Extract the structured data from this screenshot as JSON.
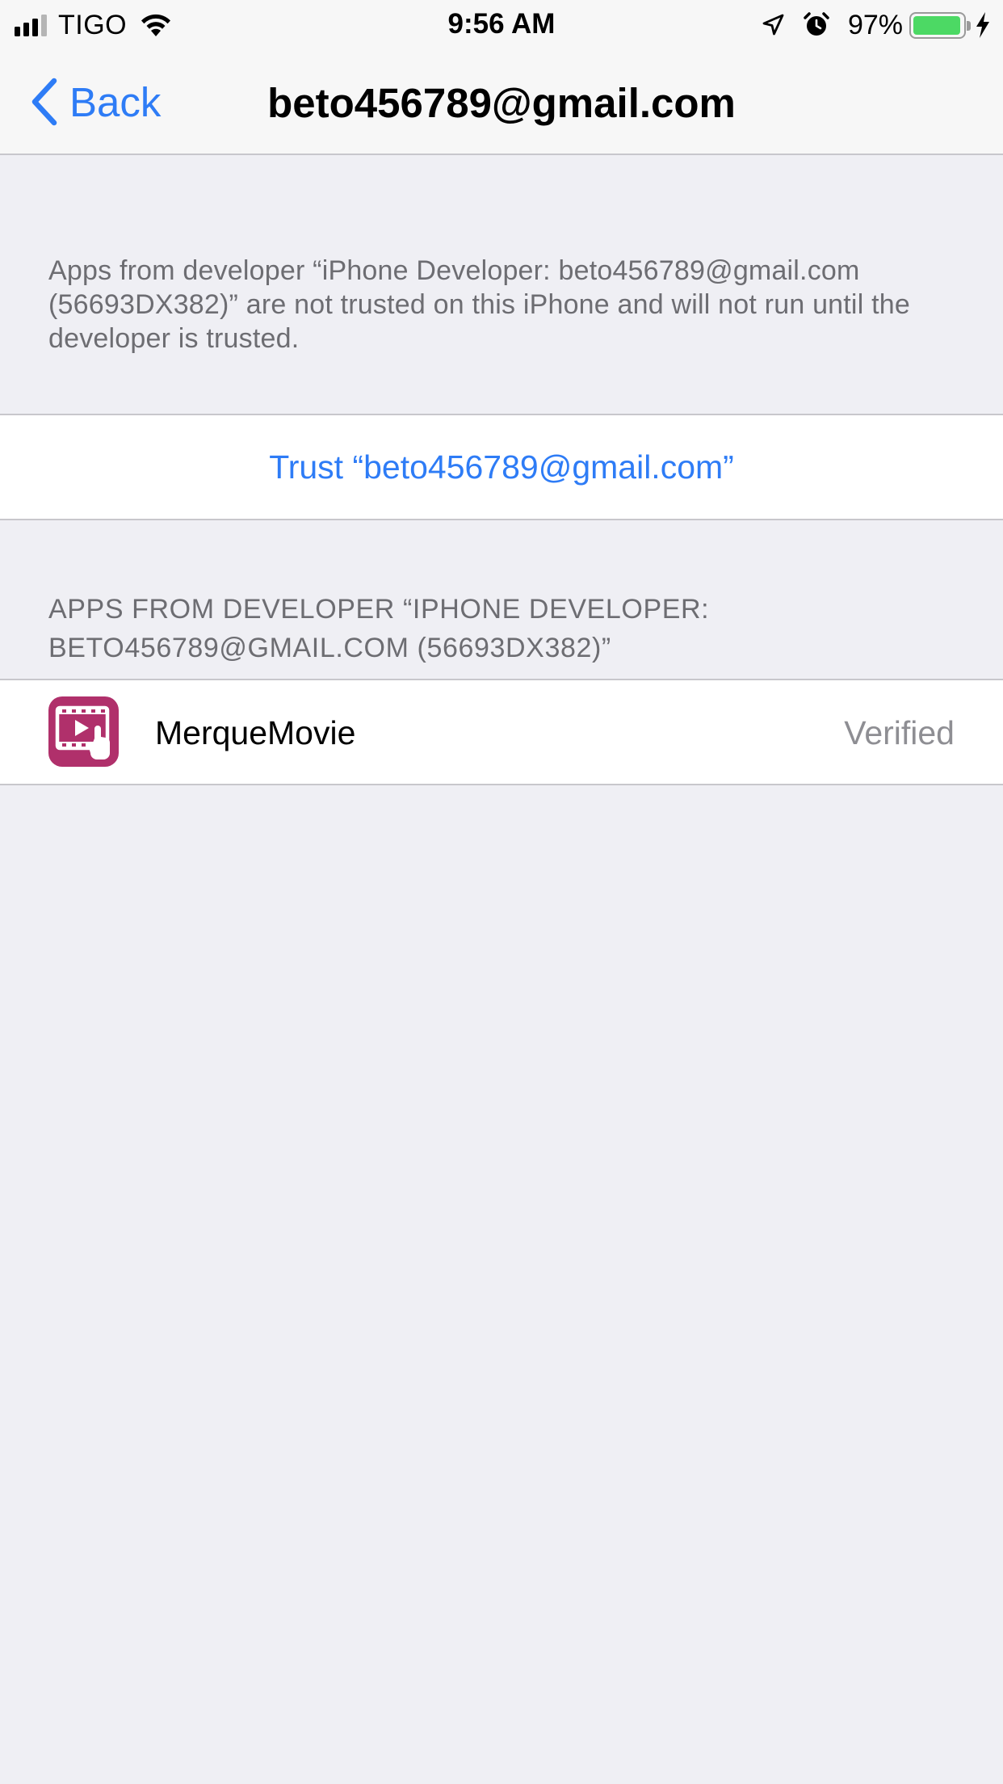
{
  "status_bar": {
    "carrier": "TIGO",
    "time": "9:56 AM",
    "battery_percent": "97%",
    "battery_level": 0.97,
    "signal_bars_filled": 3,
    "signal_bars_total": 4,
    "icons": [
      "signal-icon",
      "wifi-icon",
      "location-icon",
      "alarm-icon",
      "battery-icon",
      "charging-bolt-icon"
    ]
  },
  "nav": {
    "back_label": "Back",
    "title": "beto456789@gmail.com"
  },
  "info": {
    "text": "Apps from developer “iPhone Developer: beto456789@gmail.com (56693DX382)” are not trusted on this iPhone and will not run until the developer is trusted."
  },
  "trust": {
    "label": "Trust “beto456789@gmail.com”"
  },
  "section": {
    "header_line1": "APPS FROM DEVELOPER “IPHONE DEVELOPER:",
    "header_line2": "BETO456789@GMAIL.COM (56693DX382)”"
  },
  "apps": [
    {
      "name": "MerqueMovie",
      "status": "Verified",
      "icon": "merquemovie-app-icon"
    }
  ],
  "colors": {
    "accent": "#2e7cf6",
    "background": "#efeff4",
    "secondary_text": "#6d6d72",
    "app_icon_bg": "#b0306b",
    "battery_green": "#4cd964"
  }
}
